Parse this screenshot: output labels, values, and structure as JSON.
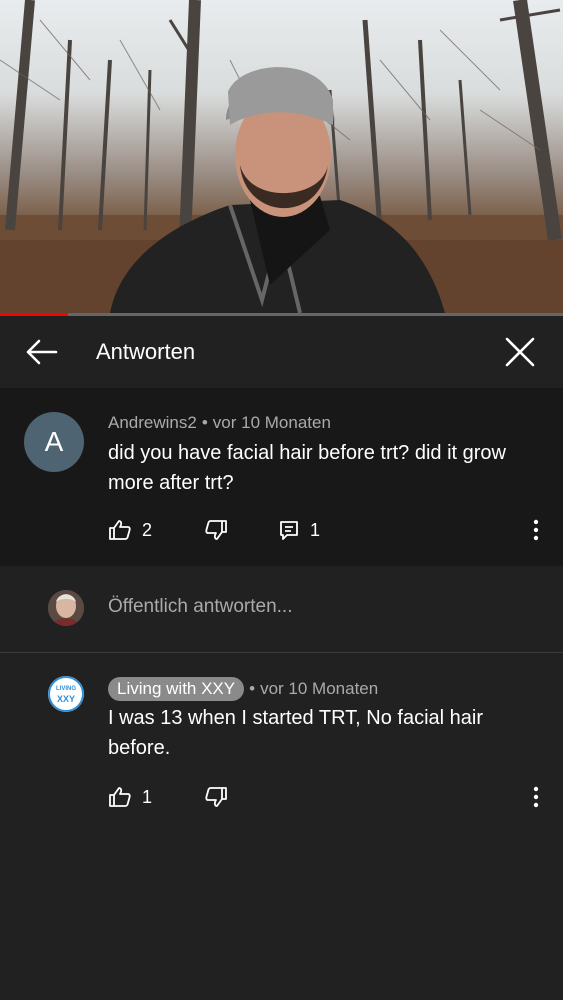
{
  "video": {
    "progress_percent": 12
  },
  "header": {
    "title": "Antworten"
  },
  "comment": {
    "avatar_letter": "A",
    "author": "Andrewins2",
    "separator": "•",
    "time": "vor 10 Monaten",
    "text": "did you have facial hair before trt? did it grow more after trt?",
    "likes": "2",
    "replies": "1"
  },
  "reply_input": {
    "placeholder": "Öffentlich antworten..."
  },
  "reply": {
    "author": "Living with XXY",
    "separator": "•",
    "time": "vor 10 Monaten",
    "text": "I was 13 when I started TRT,  No facial hair before.",
    "likes": "1",
    "avatar_text_top": "LIVING",
    "avatar_text_bottom": "XXY"
  },
  "colors": {
    "accent": "#ff0000",
    "background": "#212121",
    "comment_bg": "#181818",
    "avatar_a": "#4e6472"
  }
}
